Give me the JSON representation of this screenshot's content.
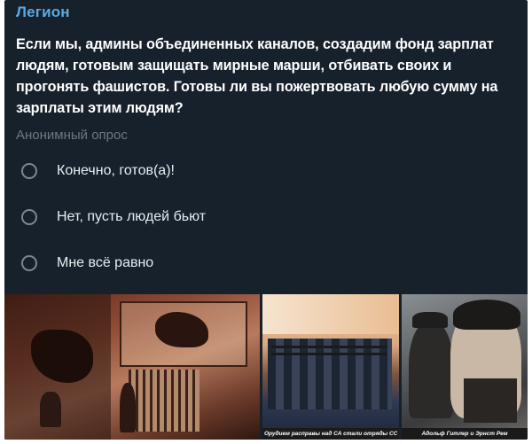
{
  "message": {
    "sender": "Легион",
    "question": "Если мы, админы объединенных каналов, создадим фонд зарплат людям, готовым защищать мирные марши, отбивать своих и прогонять фашистов. Готовы ли вы пожертвовать любую сумму на зарплаты этим людям?",
    "poll_type": "Анонимный опрос",
    "options": [
      {
        "label": "Конечно, готов(а)!"
      },
      {
        "label": "Нет, пусть людей бьют"
      },
      {
        "label": "Мне всё равно"
      }
    ]
  },
  "photos": {
    "caption_2": "Орудием расправы над СА стали отряды СС",
    "caption_3": "Адольф Гитлер и Эрнст Рем"
  }
}
